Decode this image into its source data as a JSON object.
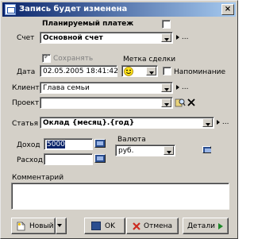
{
  "window": {
    "title": "Запись будет изменена",
    "close_symbol": "×"
  },
  "form": {
    "planned_payment_label": "Планируемый платеж",
    "planned_payment_checked": false,
    "account_label": "Счет",
    "account_value": "Основной счет",
    "save_label": "Сохранять",
    "save_checked": true,
    "deal_mark_label": "Метка сделки",
    "date_label": "Дата",
    "date_value": "02.05.2005 18:41:42",
    "reminder_label": "Напоминание",
    "reminder_checked": false,
    "client_label": "Клиент",
    "client_value": "Глава семьи",
    "project_label": "Проект",
    "project_value": "",
    "article_label": "Статья",
    "article_value": "Оклад {месяц}.{год}",
    "income_label": "Доход",
    "income_value": "5000",
    "expense_label": "Расход",
    "expense_value": "",
    "currency_label": "Валюта",
    "currency_value": "руб.",
    "comment_label": "Комментарий",
    "comment_value": "",
    "more_dots": "..."
  },
  "buttons": {
    "new_label": "Новый",
    "ok_label": "OK",
    "cancel_label": "Отмена",
    "details_label": "Детали"
  },
  "icons": {
    "window": "app-icon",
    "close": "close-icon",
    "smiley": "smiley-icon",
    "lookup": "lookup-icon",
    "clear": "clear-x-icon",
    "calculator": "calculator-icon",
    "new": "new-document-icon",
    "ok": "ok-icon",
    "cancel": "cancel-x-icon",
    "details": "details-arrow-icon"
  },
  "colors": {
    "titlebar_start": "#0a246a",
    "titlebar_end": "#a6caf0",
    "face": "#d4d0c8",
    "cancel_red": "#cc2a1f",
    "ok_blue": "#2b4e8f"
  }
}
